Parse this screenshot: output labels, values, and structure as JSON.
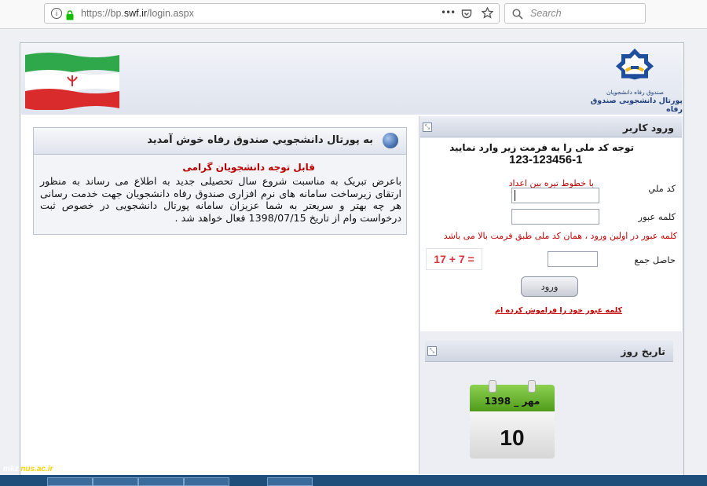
{
  "browser": {
    "url_prefix": "https://bp.",
    "url_domain": "swf.ir",
    "url_path": "/login.aspx",
    "search_placeholder": "Search",
    "more_label": "•••"
  },
  "header": {
    "logo_caption_small": "صندوق رفاه دانشجویان",
    "logo_caption": "پورتال دانشجویی صندوق رفاه"
  },
  "welcome": {
    "title": "به پورتال دانشجويي صندوق رفاه خوش آمديد",
    "subtitle": "قابل توجه دانشجویان گرامی",
    "body": "باعرض تبریک به مناسبت شروع سال تحصیلی جدید به اطلاع می رساند به منظور ارتقای زیرساخت سامانه های نرم افزاری صندوق رفاه دانشجویان جهت خدمت رسانی هر چه بهتر و سریعتر به شما عزیزان سامانه پورتال دانشجویی در خصوص ثبت درخواست وام از تاریخ 1398/07/15 فعال خواهد شد ."
  },
  "login": {
    "panel_title": "ورود کاربر",
    "instruction": "توجه کد ملی را به فرمت زیر وارد نمایید",
    "format_example": "123-123456-1",
    "hint": "با خطوط تیره بین اعداد",
    "national_code_label": "کد ملي",
    "password_label": "کلمه عبور",
    "password_note": "کلمه عبور در اولین ورود ، همان کد ملی طبق فرمت بالا می باشد",
    "sum_label": "حاصل جمع",
    "captcha": "17 + 7 =",
    "submit_label": "ورود",
    "forgot_label": "کلمه عبور خود را فراموش کرده ام",
    "national_code_value": "",
    "password_value": "",
    "sum_value": ""
  },
  "date": {
    "panel_title": "تاريخ روز",
    "month_year": "مهر _ 1398",
    "day": "10"
  },
  "watermark": {
    "prefix": "mkz.",
    "suffix": "nus.ac.ir"
  },
  "colors": {
    "accent_red": "#c00000",
    "captcha_red": "#e0313b",
    "calendar_green": "#6ab82c",
    "header_blue": "#dfe4ee"
  }
}
